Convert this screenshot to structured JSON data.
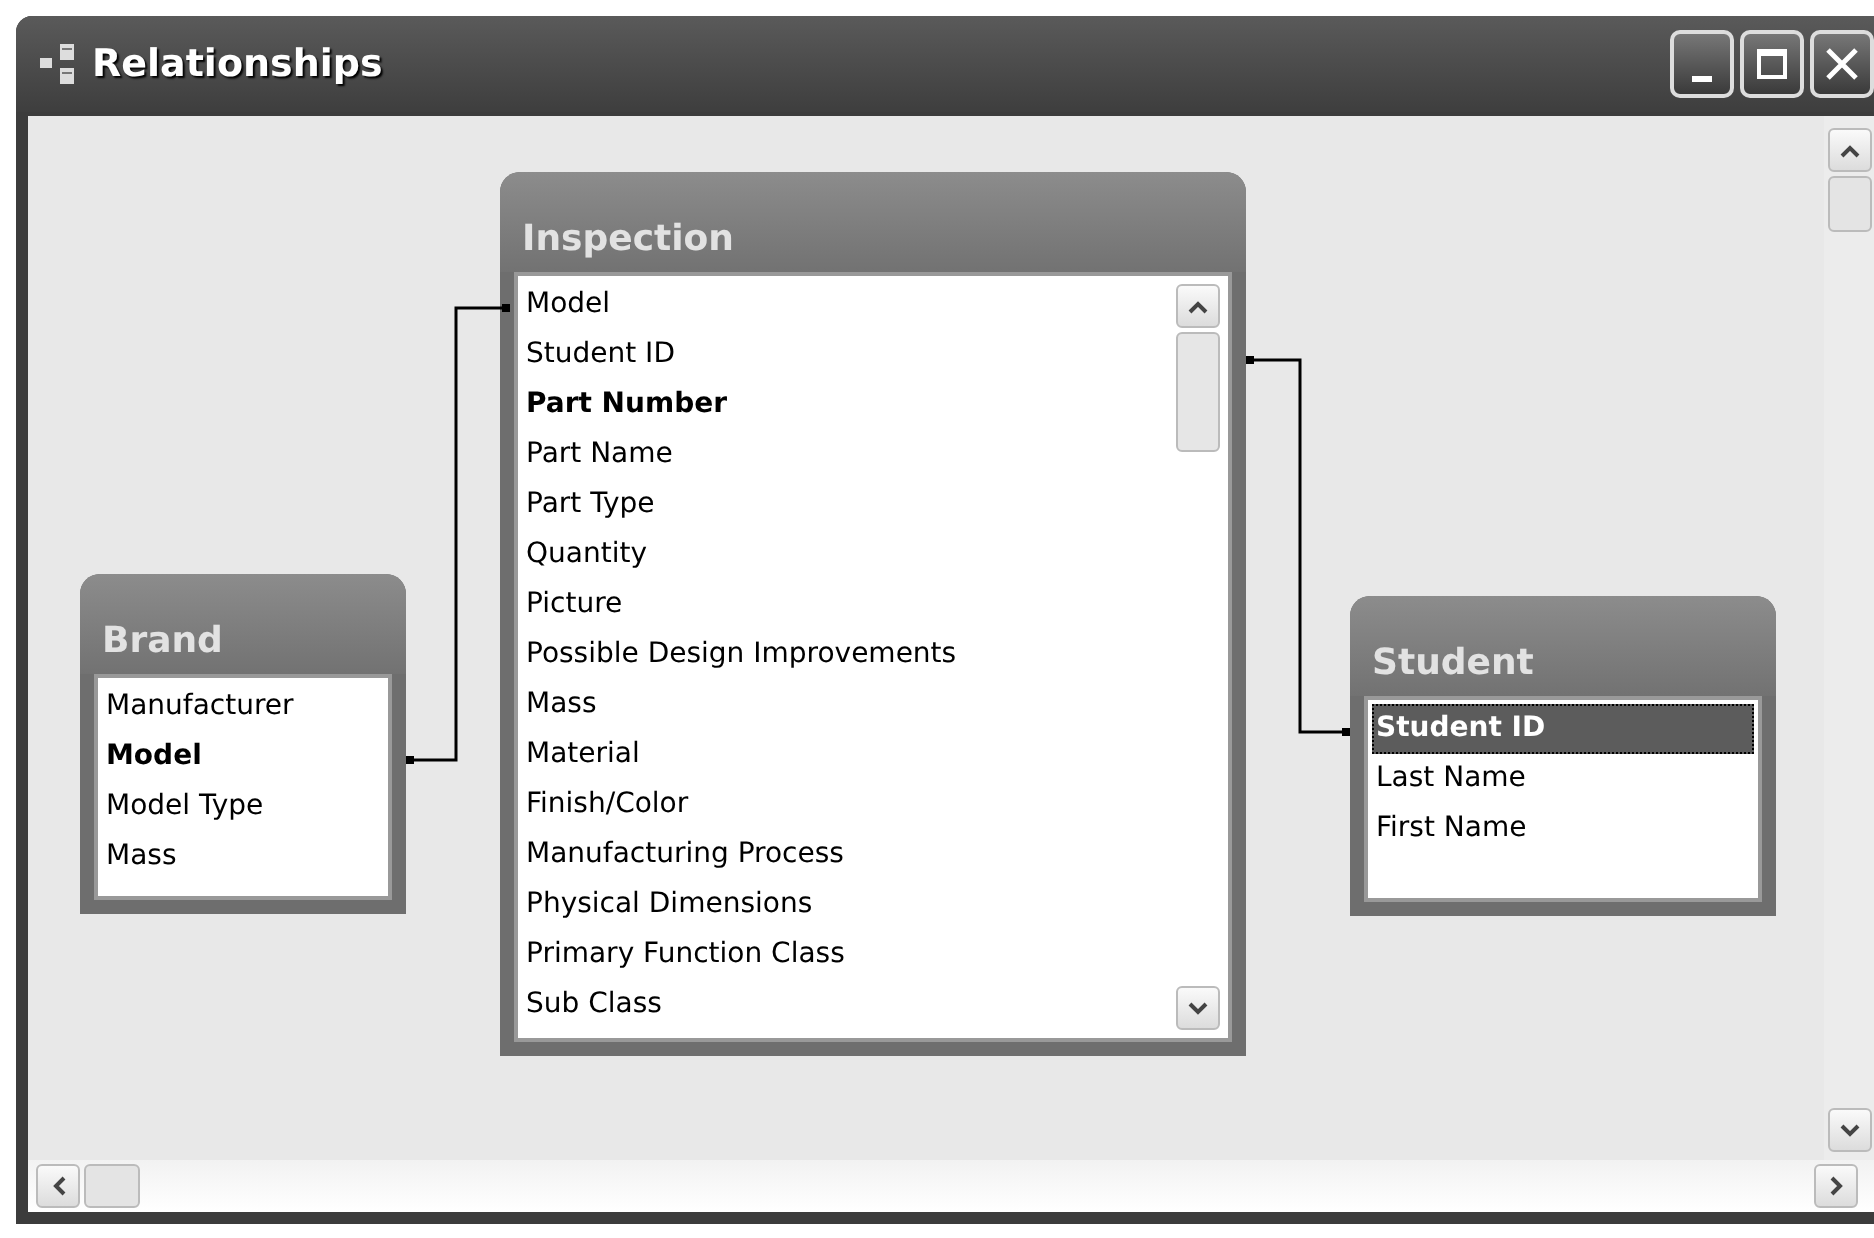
{
  "window": {
    "title": "Relationships"
  },
  "tables": [
    {
      "name": "Brand",
      "scrollable": false,
      "fields": [
        {
          "label": "Manufacturer",
          "key": false,
          "selected": false
        },
        {
          "label": "Model",
          "key": true,
          "selected": false
        },
        {
          "label": "Model Type",
          "key": false,
          "selected": false
        },
        {
          "label": "Mass",
          "key": false,
          "selected": false
        }
      ]
    },
    {
      "name": "Inspection",
      "scrollable": true,
      "fields": [
        {
          "label": "Model",
          "key": false,
          "selected": false
        },
        {
          "label": "Student ID",
          "key": false,
          "selected": false
        },
        {
          "label": "Part Number",
          "key": true,
          "selected": false
        },
        {
          "label": "Part Name",
          "key": false,
          "selected": false
        },
        {
          "label": "Part Type",
          "key": false,
          "selected": false
        },
        {
          "label": "Quantity",
          "key": false,
          "selected": false
        },
        {
          "label": "Picture",
          "key": false,
          "selected": false
        },
        {
          "label": "Possible Design Improvements",
          "key": false,
          "selected": false
        },
        {
          "label": "Mass",
          "key": false,
          "selected": false
        },
        {
          "label": "Material",
          "key": false,
          "selected": false
        },
        {
          "label": "Finish/Color",
          "key": false,
          "selected": false
        },
        {
          "label": "Manufacturing Process",
          "key": false,
          "selected": false
        },
        {
          "label": "Physical Dimensions",
          "key": false,
          "selected": false
        },
        {
          "label": "Primary Function Class",
          "key": false,
          "selected": false
        },
        {
          "label": "Sub Class",
          "key": false,
          "selected": false
        }
      ]
    },
    {
      "name": "Student",
      "scrollable": false,
      "fields": [
        {
          "label": "Student ID",
          "key": true,
          "selected": true
        },
        {
          "label": "Last Name",
          "key": false,
          "selected": false
        },
        {
          "label": "First Name",
          "key": false,
          "selected": false
        }
      ]
    }
  ]
}
